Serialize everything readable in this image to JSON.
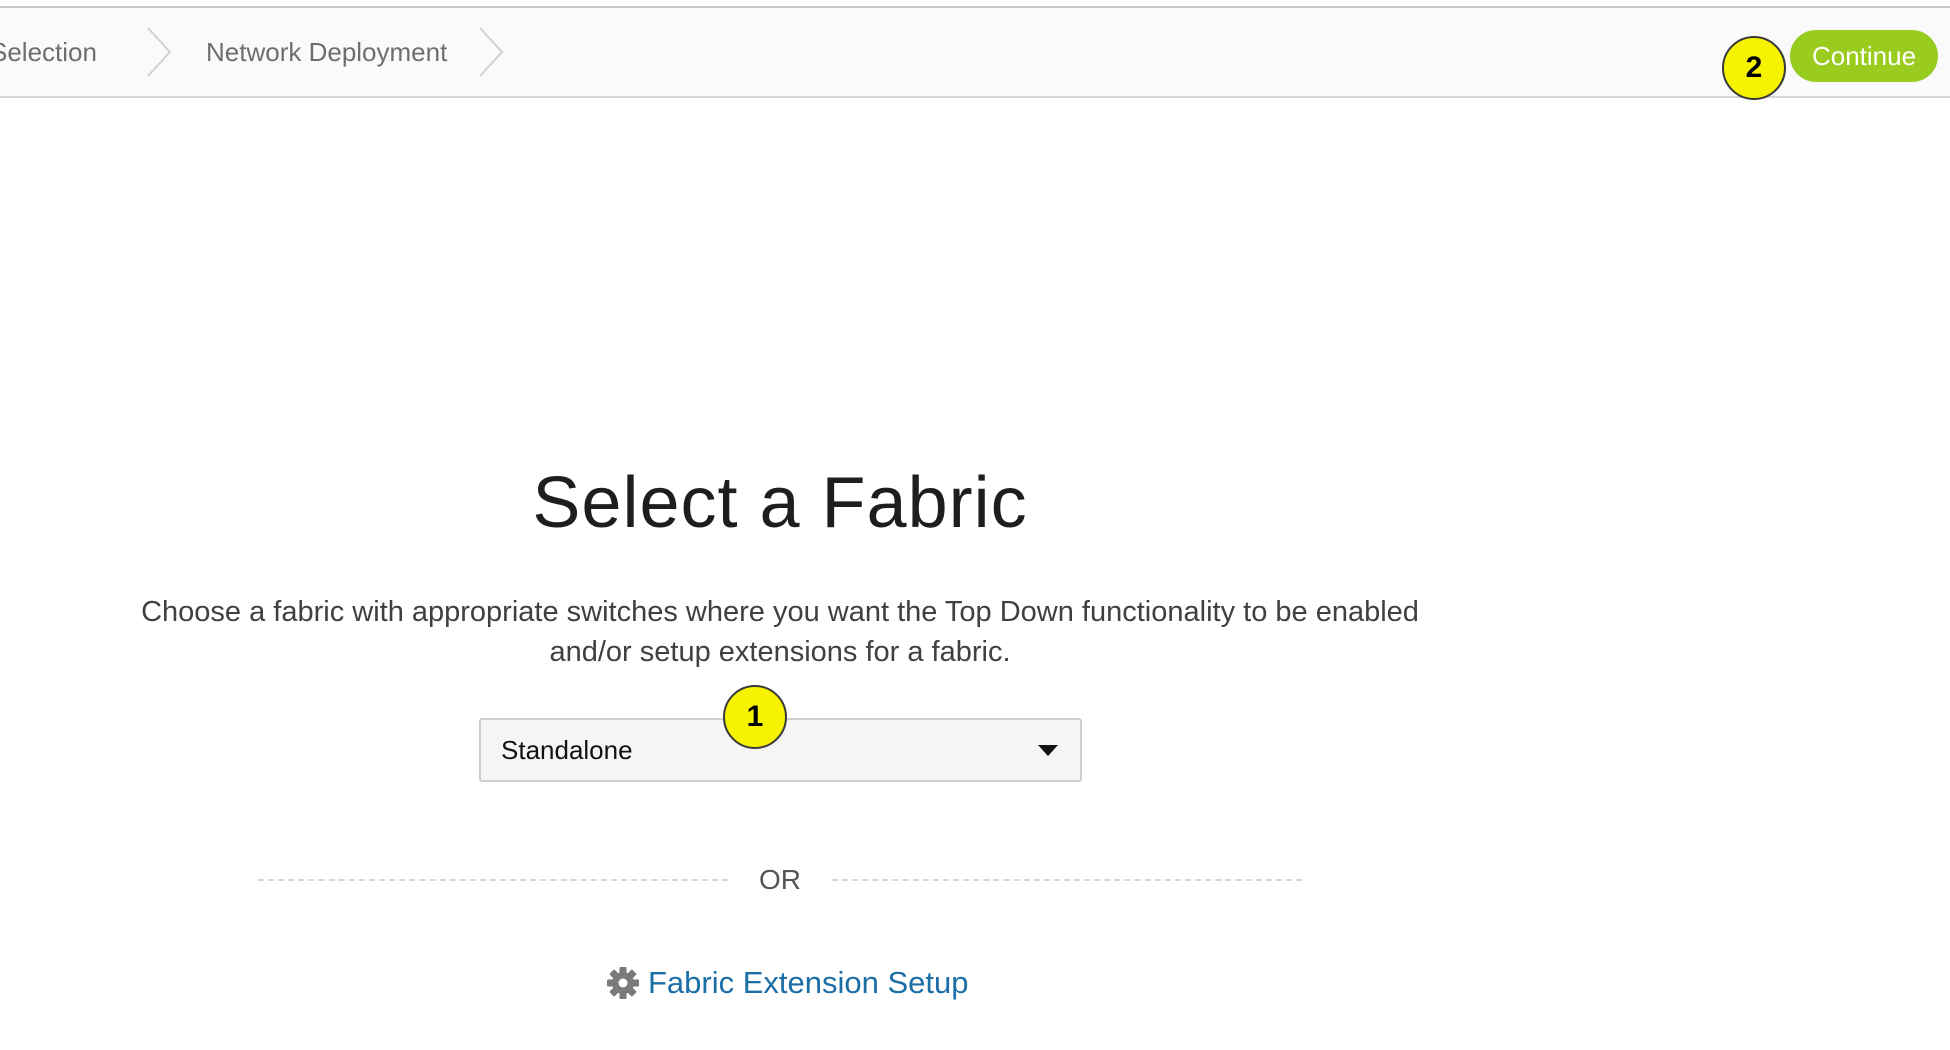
{
  "breadcrumb": {
    "items": [
      {
        "label": "Selection"
      },
      {
        "label": "Network Deployment"
      }
    ]
  },
  "header": {
    "continue_label": "Continue"
  },
  "annotations": {
    "marker_1": "1",
    "marker_2": "2",
    "marker_color": "#f6f200"
  },
  "main": {
    "title": "Select a Fabric",
    "description_line1": "Choose a fabric with appropriate switches where you want the Top Down functionality to be enabled",
    "description_line2": "and/or setup extensions for a fabric.",
    "fabric_select": {
      "selected": "Standalone",
      "icon": "caret-down-icon"
    },
    "separator_text": "OR",
    "extension_link": {
      "label": "Fabric Extension Setup",
      "icon": "gear-icon"
    }
  },
  "colors": {
    "accent_green": "#99cc1f",
    "link_blue": "#1b6ea6"
  }
}
